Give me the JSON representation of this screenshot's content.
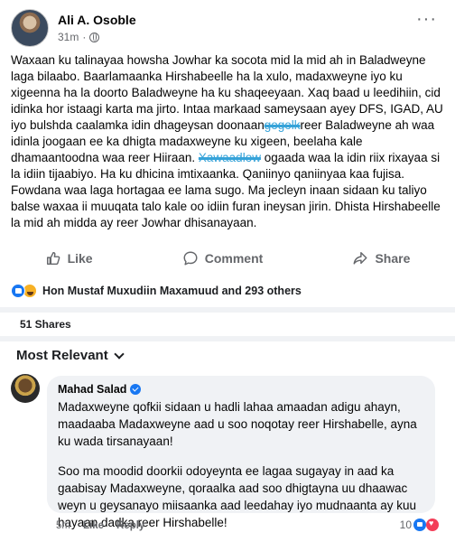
{
  "post": {
    "author": "Ali A. Osoble",
    "time": "31m",
    "separator": "·",
    "more": "···",
    "body": {
      "line1": "Waxaan ku talinayaa howsha Jowhar ka socota mid la mid ah in Baladweyne laga bilaabo. Baarlamaanka Hirshabeelle ha la xulo, madaxweyne iyo ku xigeenna ha la doorto Baladweyne ha ku shaqeeyaan. Xaq baad u leedihiin, cid idinka hor istaagi karta ma jirto. Intaa markaad sameysaan ayey DFS, IGAD, AU iyo bulshda caalamka idin dhageysan doonaan",
      "scribble1": "gogolk",
      "line2": "reer Baladweyne ah waa idinla joogaan ee ka dhigta madaxweyne ku xigeen, beelaha kale dhamaantoodna waa reer Hiiraan.",
      "scribble2": "Xawaadlow",
      "line3": "ogaada waa la idin riix rixayaa si la idiin tijaabiyo. Ha ku dhicina imtixaanka. Qaniinyo qaniinyaa kaa fujisa. Fowdana waa laga hortagaa ee lama sugo. Ma jecleyn inaan sidaan ku taliyo balse waxaa ii muuqata talo kale oo idiin furan ineysan jirin. Dhista Hirshabeelle la mid ah midda ay reer Jowhar dhisanayaan."
    }
  },
  "actions": {
    "like": "Like",
    "comment": "Comment",
    "share": "Share"
  },
  "reactions": {
    "text": "Hon Mustaf Muxudiin Maxamuud and 293 others"
  },
  "shares": "51 Shares",
  "sort": {
    "label": "Most Relevant"
  },
  "comment": {
    "author": "Mahad Salad",
    "paragraph1": "Madaxweyne qofkii sidaan u hadli lahaa amaadan adigu ahayn, maadaaba Madaxweyne aad u soo noqotay reer Hirshabelle, ayna ku wada tirsanayaan!",
    "paragraph2": "Soo ma moodid doorkii odoyeynta ee lagaa sugayay in aad ka gaabisay Madaxweyne, qoraalka aad soo dhigtayna uu dhaawac weyn u geysanayo miisaanka aad leedahay iyo mudnaanta ay kuu hayaan dadka reer Hirshabelle!",
    "time": "5m",
    "like": "Like",
    "reply": "Reply",
    "reaction_count": "10"
  },
  "icons": {
    "globe": "globe-icon",
    "like": "thumbs-up-icon",
    "comment": "speech-bubble-icon",
    "share": "share-arrow-icon",
    "verified": "verified-badge-icon"
  },
  "colors": {
    "brand": "#1877f2",
    "muted": "#65676b",
    "bubble": "#f0f2f5",
    "scribble": "#36a3d9"
  }
}
